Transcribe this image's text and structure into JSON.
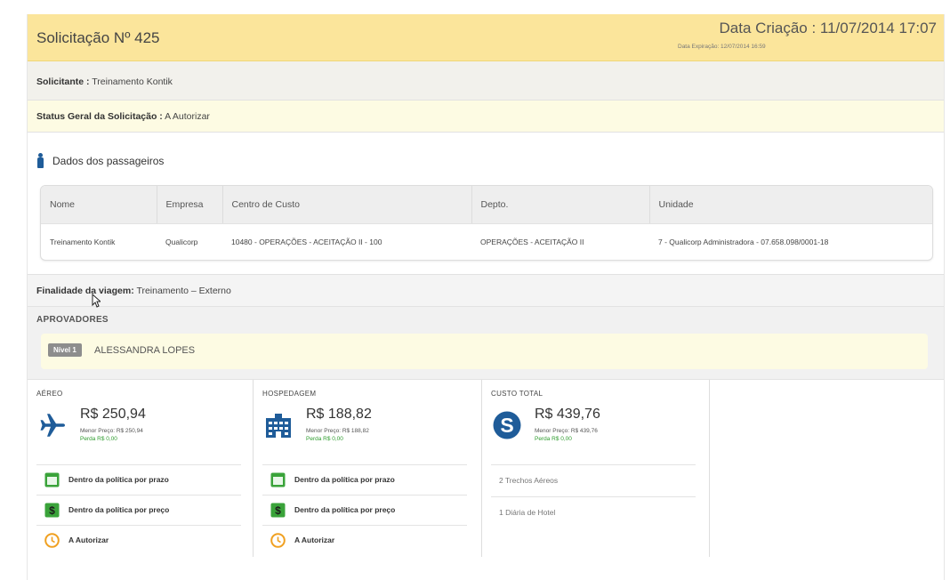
{
  "header": {
    "title": "Solicitação Nº 425",
    "created": "Data Criação : 11/07/2014 17:07",
    "expiration": "Data Expiração: 12/07/2014 16:59"
  },
  "requester": {
    "label": "Solicitante :",
    "value": "Treinamento Kontik"
  },
  "status": {
    "label": "Status Geral da Solicitação :",
    "value": "A Autorizar"
  },
  "passengers": {
    "section_title": "Dados dos passageiros",
    "columns": [
      "Nome",
      "Empresa",
      "Centro de Custo",
      "Depto.",
      "Unidade"
    ],
    "rows": [
      [
        "Treinamento Kontik",
        "Qualicorp",
        "10480 - OPERAÇÕES - ACEITAÇÃO II - 100",
        "OPERAÇÕES - ACEITAÇÃO II",
        "7 - Qualicorp Administradora - 07.658.098/0001-18"
      ]
    ]
  },
  "purpose": {
    "label": "Finalidade da viagem:",
    "value": "Treinamento – Externo"
  },
  "approvers": {
    "title": "APROVADORES",
    "items": [
      {
        "level": "Nível 1",
        "name": "ALESSANDRA LOPES"
      }
    ]
  },
  "costs": {
    "air": {
      "title": "AÉREO",
      "price": "R$ 250,94",
      "lowest": "Menor Preço: R$ 250,94",
      "loss": "Perda R$ 0,00",
      "policies": [
        "Dentro da política por prazo",
        "Dentro da política por preço",
        "A Autorizar"
      ]
    },
    "hotel": {
      "title": "HOSPEDAGEM",
      "price": "R$ 188,82",
      "lowest": "Menor Preço: R$ 188,82",
      "loss": "Perda R$ 0,00",
      "policies": [
        "Dentro da política por prazo",
        "Dentro da política por preço",
        "A Autorizar"
      ]
    },
    "total": {
      "title": "CUSTO TOTAL",
      "price": "R$ 439,76",
      "lowest": "Menor Preço: R$ 439,76",
      "loss": "Perda R$ 0,00",
      "details": [
        "2 Trechos Aéreos",
        "1 Diária de Hotel"
      ]
    }
  },
  "colors": {
    "header_bg": "#fbe59b",
    "status_bg": "#fdfbe3",
    "icon_blue": "#1f5c99",
    "policy_green": "#3aa33a",
    "clock_orange": "#f0a020",
    "loss_green": "#2e9c2e"
  },
  "icons": [
    "person-icon",
    "airplane-icon",
    "hotel-icon",
    "dollar-icon",
    "calendar-icon",
    "money-icon",
    "clock-icon",
    "mouse-cursor-icon"
  ]
}
